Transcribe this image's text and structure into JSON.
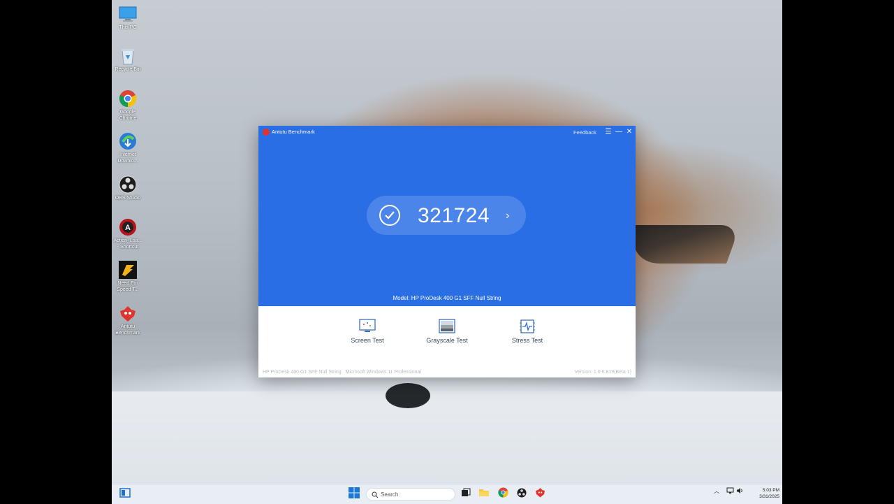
{
  "desktop": {
    "icons": [
      {
        "label": "This PC",
        "icon": "this-pc-icon"
      },
      {
        "label": "Recycle Bin",
        "icon": "recycle-bin-icon"
      },
      {
        "label": "Google\nChrome",
        "icon": "chrome-icon"
      },
      {
        "label": "Internet\nDownlo...",
        "icon": "internet-download-manager-icon"
      },
      {
        "label": "OBS Studio",
        "icon": "obs-studio-icon"
      },
      {
        "label": "Action_Loa...\n- Shortcut",
        "icon": "action-shortcut-icon"
      },
      {
        "label": "Need For\nSpeed T...",
        "icon": "need-for-speed-icon"
      },
      {
        "label": "Antutu\nBenchmark",
        "icon": "antutu-icon"
      }
    ]
  },
  "window": {
    "title": "Antutu Benchmark",
    "feedback": "Feedback",
    "score": "321724",
    "model": "Model: HP ProDesk 400 G1 SFF Null String",
    "tools": [
      {
        "label": "Screen Test",
        "icon": "screen-test-icon"
      },
      {
        "label": "Grayscale Test",
        "icon": "grayscale-test-icon"
      },
      {
        "label": "Stress Test",
        "icon": "stress-test-icon"
      }
    ],
    "footer": {
      "device": "HP ProDesk 400 G1 SFF Null String",
      "os": "Microsoft Windows 11 Professional",
      "version": "Version: 1.0.0.819(Beta 1)"
    }
  },
  "taskbar": {
    "search_placeholder": "Search",
    "time": "5:03 PM",
    "date": "3/31/2025"
  },
  "colors": {
    "accent": "#2a6ee6",
    "antutu_red": "#e0332c",
    "taskbar": "#e9eef5"
  }
}
